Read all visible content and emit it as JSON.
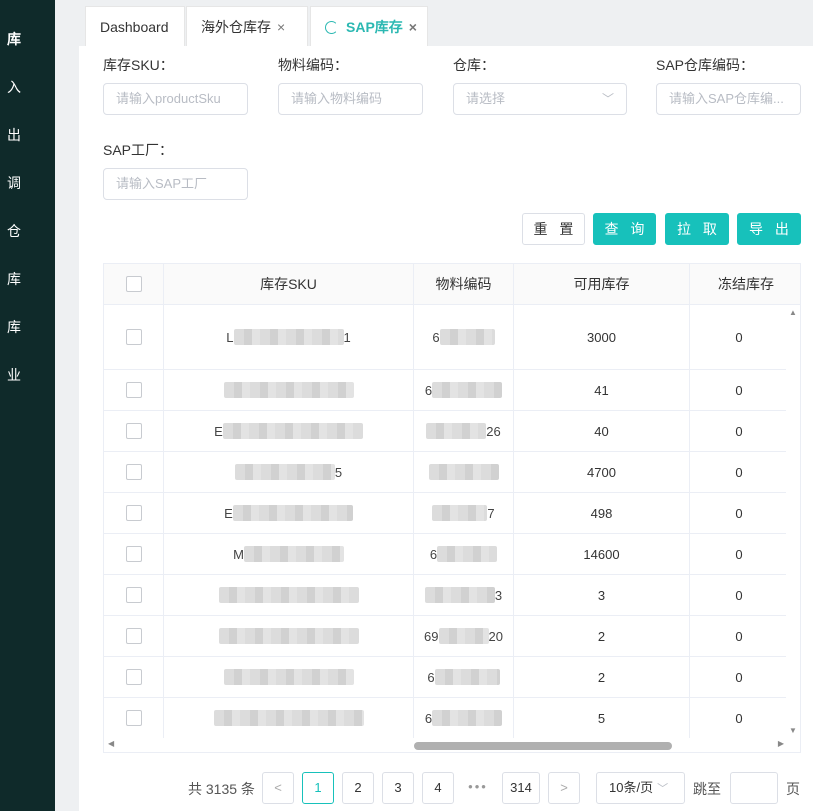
{
  "sidebar": {
    "items": [
      "库",
      "入",
      "出",
      "调",
      "仓",
      "库",
      "库",
      "业"
    ]
  },
  "tabs": [
    {
      "label": "Dashboard"
    },
    {
      "label": "海外仓库存",
      "close": "×"
    },
    {
      "label": "SAP库存",
      "close": "×"
    }
  ],
  "filters": {
    "sku_label": "库存SKU：",
    "sku_placeholder": "请输入productSku",
    "material_label": "物料编码：",
    "material_placeholder": "请输入物料编码",
    "warehouse_label": "仓库：",
    "warehouse_placeholder": "请选择",
    "sap_wh_label": "SAP仓库编码：",
    "sap_wh_placeholder": "请输入SAP仓库编...",
    "factory_label": "SAP工厂：",
    "factory_placeholder": "请输入SAP工厂"
  },
  "buttons": {
    "reset": "重 置",
    "query": "查 询",
    "pull": "拉 取",
    "export": "导 出"
  },
  "table": {
    "headers": [
      "库存SKU",
      "物料编码",
      "可用库存",
      "冻结库存"
    ],
    "rows": [
      {
        "sku_a": "L",
        "sku_b": "1",
        "mat_a": "6",
        "mat_b": "",
        "avail": "3000",
        "frozen": "0"
      },
      {
        "sku_a": "",
        "sku_b": "",
        "mat_a": "6",
        "mat_b": "",
        "avail": "41",
        "frozen": "0"
      },
      {
        "sku_a": "E",
        "sku_b": "",
        "mat_a": "",
        "mat_b": "26",
        "avail": "40",
        "frozen": "0"
      },
      {
        "sku_a": "",
        "sku_b": "5",
        "mat_a": "",
        "mat_b": "",
        "avail": "4700",
        "frozen": "0"
      },
      {
        "sku_a": "E",
        "sku_b": "",
        "mat_a": "",
        "mat_b": "7",
        "avail": "498",
        "frozen": "0"
      },
      {
        "sku_a": "M",
        "sku_b": "",
        "mat_a": "6",
        "mat_b": "",
        "avail": "14600",
        "frozen": "0"
      },
      {
        "sku_a": "",
        "sku_b": "",
        "mat_a": "",
        "mat_b": "3",
        "avail": "3",
        "frozen": "0"
      },
      {
        "sku_a": "",
        "sku_b": "",
        "mat_a": "69",
        "mat_b": "20",
        "avail": "2",
        "frozen": "0"
      },
      {
        "sku_a": "",
        "sku_b": "",
        "mat_a": "6",
        "mat_b": "",
        "avail": "2",
        "frozen": "0"
      },
      {
        "sku_a": "",
        "sku_b": "",
        "mat_a": "6",
        "mat_b": "",
        "avail": "5",
        "frozen": "0"
      }
    ]
  },
  "pagination": {
    "total": "共 3135 条",
    "pages": [
      "1",
      "2",
      "3",
      "4"
    ],
    "ellipsis": "•••",
    "last": "314",
    "page_size": "10条/页",
    "jump_label": "跳至",
    "page_suffix": "页",
    "prev": "<",
    "next": ">"
  },
  "colors": {
    "accent": "#17c1bb",
    "sidebar": "#0f2a2a"
  }
}
